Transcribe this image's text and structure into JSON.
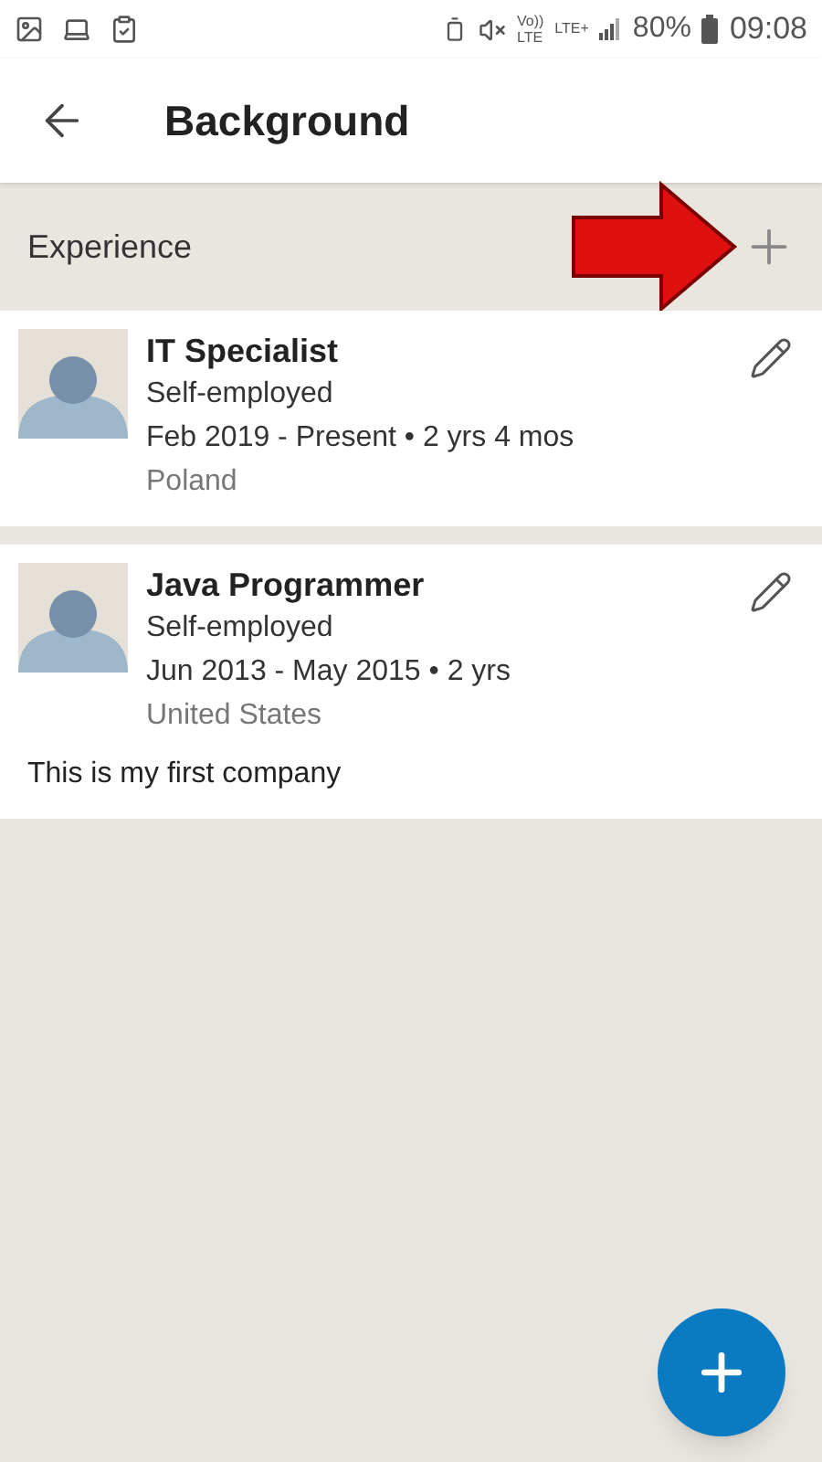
{
  "status_bar": {
    "volte": [
      "Vo))",
      "LTE"
    ],
    "network": "LTE+",
    "battery": "80%",
    "time": "09:08"
  },
  "header": {
    "title": "Background"
  },
  "section": {
    "title": "Experience"
  },
  "entries": [
    {
      "title": "IT Specialist",
      "company": "Self-employed",
      "dates": "Feb 2019 - Present • 2 yrs 4 mos",
      "location": "Poland"
    },
    {
      "title": "Java Programmer",
      "company": "Self-employed",
      "dates": "Jun 2013 - May 2015 • 2 yrs",
      "location": "United States",
      "description": "This is my first company"
    }
  ]
}
